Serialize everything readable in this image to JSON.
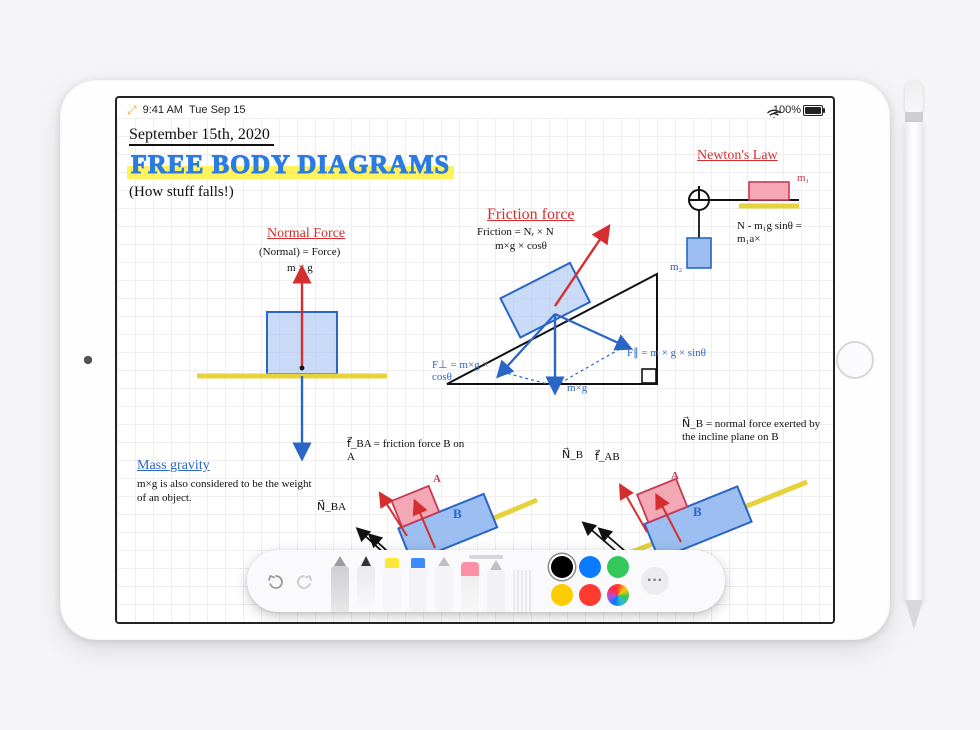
{
  "status": {
    "time": "9:41 AM",
    "date": "Tue Sep 15",
    "battery": "100%"
  },
  "toolbar_icons": [
    "check-circle",
    "camera",
    "target",
    "ellipsis",
    "compose"
  ],
  "note": {
    "date": "September 15th, 2020",
    "title": "FREE BODY DIAGRAMS",
    "subtitle": "(How stuff falls!)",
    "sections": {
      "normal": {
        "heading": "Normal Force",
        "line1": "(Normal) = Force)",
        "line2": "m × g"
      },
      "mass": {
        "heading": "Mass gravity",
        "body": "m×g is also considered to be the weight of an object."
      },
      "friction": {
        "heading": "Friction force",
        "eq1": "Friction = Nᵣ × N",
        "eq2": "m×g × cosθ",
        "fL": "F⊥ = m×g × cosθ",
        "fR": "F∥ = m × g × sinθ",
        "mg": "m×g"
      },
      "newton": {
        "heading": "Newton's Law",
        "m1": "m₁",
        "m2": "m₂",
        "eq": "N - m₁g sinθ = m₁a×"
      },
      "blocks": {
        "a": "A",
        "b": "B",
        "fBA": "f⃗_BA = friction force B on A",
        "nBA": "N⃗_BA",
        "nB": "N⃗_B",
        "fAB": "f⃗_AB",
        "nDef": "N⃗_B = normal force exerted by the incline plane on B"
      }
    }
  },
  "palette": {
    "colors": [
      "#000000",
      "#0a7aff",
      "#34c759",
      "#ffcc00",
      "#ff3b30",
      "wheel"
    ],
    "selected": 0
  }
}
